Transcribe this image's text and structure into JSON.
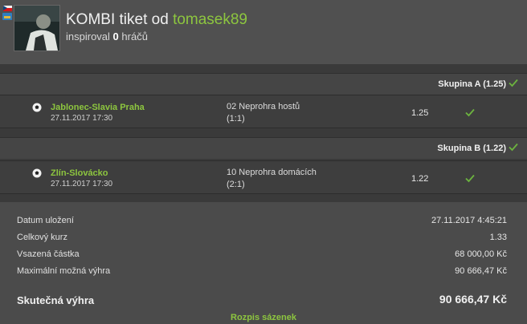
{
  "header": {
    "title_prefix": "KOMBI tiket od",
    "username": "tomasek89",
    "inspired_prefix": "inspiroval",
    "inspired_count": "0",
    "inspired_suffix": "hráčů"
  },
  "groups": [
    {
      "label": "Skupina A (1.25)",
      "match": {
        "name": "Jablonec-Slavia Praha",
        "date": "27.11.2017 17:30",
        "bet": "02 Neprohra hostů",
        "score": "(1:1)",
        "odd": "1.25"
      }
    },
    {
      "label": "Skupina B (1.22)",
      "match": {
        "name": "Zlín-Slovácko",
        "date": "27.11.2017 17:30",
        "bet": "10 Neprohra domácích",
        "score": "(2:1)",
        "odd": "1.22"
      }
    }
  ],
  "summary": {
    "rows": [
      {
        "label": "Datum uložení",
        "value": "27.11.2017 4:45:21"
      },
      {
        "label": "Celkový kurz",
        "value": "1.33"
      },
      {
        "label": "Vsazená částka",
        "value": "68 000,00 Kč"
      },
      {
        "label": "Maximální možná výhra",
        "value": "90 666,47 Kč"
      }
    ],
    "total_label": "Skutečná výhra",
    "total_value": "90 666,47 Kč",
    "link": "Rozpis sázenek"
  },
  "colors": {
    "accent": "#8dc63f",
    "win_check": "#6cb33f"
  },
  "icons": [
    "czech-flag-icon",
    "site-logo-icon",
    "soccer-ball-icon",
    "checkmark-icon"
  ]
}
